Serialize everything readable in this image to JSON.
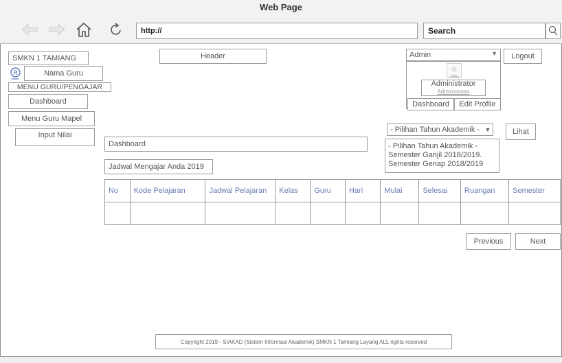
{
  "browser": {
    "title": "Web Page",
    "url": "http://",
    "search_label": "Search"
  },
  "sidebar": {
    "school": "SMKN 1 TAMIANG",
    "teacher_name": "Nama Guru",
    "menu_title": "MENU GURU/PENGAJAR",
    "items": [
      "Dashboard",
      "Menu Guru Mapel",
      "Input Nilai"
    ]
  },
  "header": {
    "label": "Header"
  },
  "user": {
    "select_value": "Admin",
    "logout": "Logout",
    "name": "Administrator",
    "role": "Administrator",
    "tabs": [
      "Dashboard",
      "Edit Profile"
    ]
  },
  "year_filter": {
    "selected": "- Pilihan Tahun Akademik -",
    "options": [
      "- Pilihan Tahun Akademik -",
      "Semester Ganjil 2018/2019.",
      "Semester Genap 2018/2019"
    ],
    "view_button": "Lihat"
  },
  "main": {
    "breadcrumb": "Dashboard",
    "section_title": "Jadwal Mengajar Anda 2019"
  },
  "table": {
    "headers": [
      "No",
      "Kode Pelajaran",
      "Jadwal Pelajaran",
      "Kelas",
      "Guru",
      "Hari",
      "Mulai",
      "Selesai",
      "Ruangan",
      "Semester"
    ]
  },
  "pagination": {
    "previous": "Previous",
    "next": "Next"
  },
  "footer": {
    "text": "Copyright 2019 - SIAKAD (Sistem Informasi Akademik) SMKN 1 Tamiang Layang ALL rights reserved"
  },
  "colors": {
    "table_text": "#6a7db4",
    "border": "#9a9a9a",
    "chrome": "#f2f2f2"
  }
}
